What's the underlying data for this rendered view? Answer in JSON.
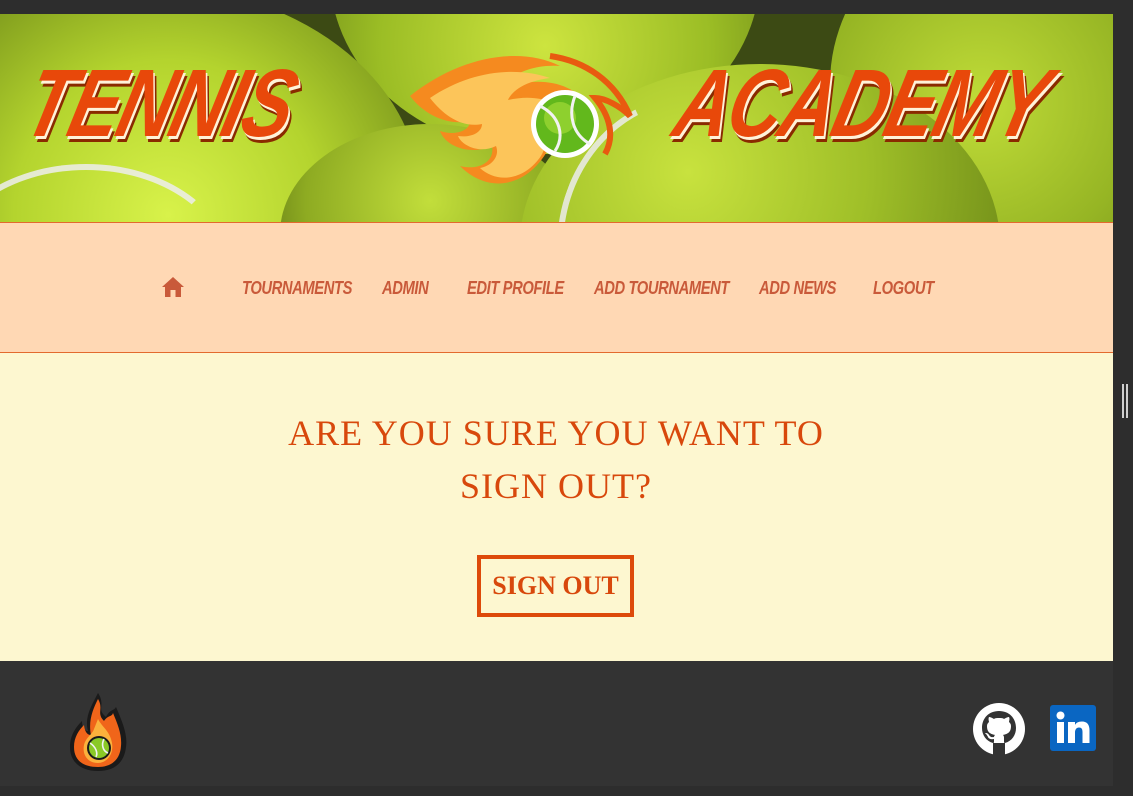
{
  "banner": {
    "title_left": "TENNIS",
    "title_right": "ACADEMY",
    "logo_icon": "flaming-tennis-ball-icon"
  },
  "nav": {
    "home_icon": "home-icon",
    "items": [
      {
        "label": "TOURNAMENTS"
      },
      {
        "label": "ADMIN"
      },
      {
        "label": "EDIT PROFILE"
      },
      {
        "label": "ADD TOURNAMENT"
      },
      {
        "label": "ADD NEWS"
      },
      {
        "label": "LOGOUT"
      }
    ]
  },
  "main": {
    "question_line1": "ARE YOU SURE YOU WANT TO",
    "question_line2": "SIGN OUT?",
    "signout_label": "SIGN OUT"
  },
  "footer": {
    "logo_icon": "flame-ball-logo-icon",
    "github_icon": "github-icon",
    "linkedin_icon": "linkedin-icon"
  },
  "colors": {
    "accent": "#dd4a0a",
    "nav_bg": "#ffd8b4",
    "nav_text": "#c95a3a",
    "main_bg": "#fdf7d0",
    "footer_bg": "#333333",
    "linkedin_blue": "#0a66c2"
  }
}
